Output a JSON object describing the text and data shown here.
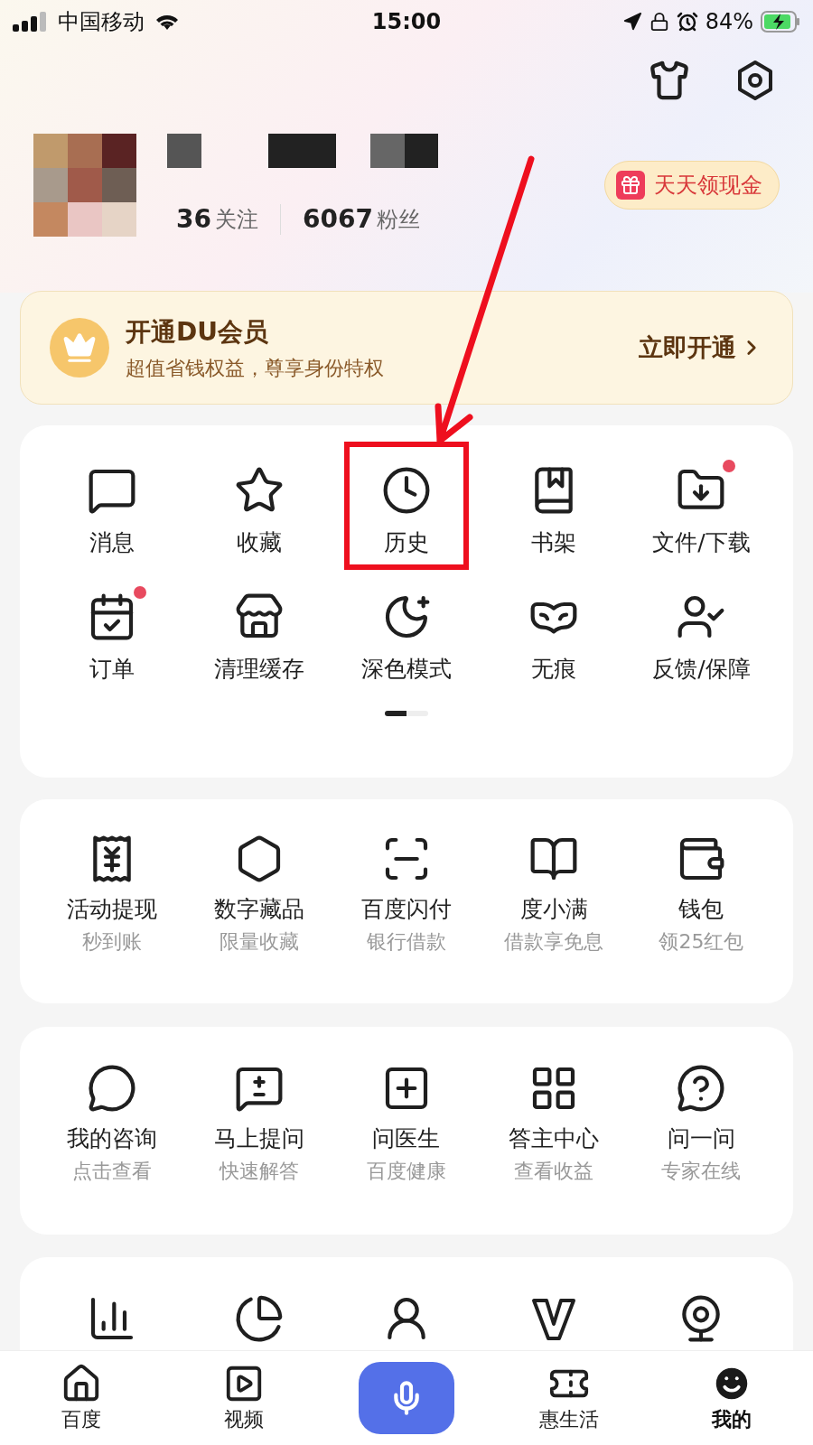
{
  "status_bar": {
    "carrier": "中国移动",
    "time": "15:00",
    "battery": "84%"
  },
  "profile": {
    "following_count": "36",
    "following_label": "关注",
    "followers_count": "6067",
    "followers_label": "粉丝",
    "cash_button": "天天领现金"
  },
  "vip_banner": {
    "title": "开通DU会员",
    "subtitle": "超值省钱权益，尊享身份特权",
    "action": "立即开通"
  },
  "shortcut_grid": {
    "items": [
      {
        "label": "消息",
        "badge": false,
        "highlighted": false
      },
      {
        "label": "收藏",
        "badge": false,
        "highlighted": false
      },
      {
        "label": "历史",
        "badge": false,
        "highlighted": true
      },
      {
        "label": "书架",
        "badge": false,
        "highlighted": false
      },
      {
        "label": "文件/下载",
        "badge": true,
        "highlighted": false
      },
      {
        "label": "订单",
        "badge": true,
        "highlighted": false
      },
      {
        "label": "清理缓存",
        "badge": false,
        "highlighted": false
      },
      {
        "label": "深色模式",
        "badge": false,
        "highlighted": false
      },
      {
        "label": "无痕",
        "badge": false,
        "highlighted": false
      },
      {
        "label": "反馈/保障",
        "badge": false,
        "highlighted": false
      }
    ],
    "pages": [
      {
        "selected": true
      },
      {
        "selected": false
      }
    ]
  },
  "finance_grid": {
    "items": [
      {
        "label": "活动提现",
        "subtitle": "秒到账"
      },
      {
        "label": "数字藏品",
        "subtitle": "限量收藏"
      },
      {
        "label": "百度闪付",
        "subtitle": "银行借款"
      },
      {
        "label": "度小满",
        "subtitle": "借款享免息"
      },
      {
        "label": "钱包",
        "subtitle": "领25红包"
      }
    ]
  },
  "qa_grid": {
    "items": [
      {
        "label": "我的咨询",
        "subtitle": "点击查看"
      },
      {
        "label": "马上提问",
        "subtitle": "快速解答"
      },
      {
        "label": "问医生",
        "subtitle": "百度健康"
      },
      {
        "label": "答主中心",
        "subtitle": "查看收益"
      },
      {
        "label": "问一问",
        "subtitle": "专家在线"
      }
    ]
  },
  "bottom_nav": [
    {
      "kind": "tab",
      "label": "百度",
      "selected": false
    },
    {
      "kind": "tab",
      "label": "视频",
      "selected": false
    },
    {
      "kind": "voice",
      "selected": false
    },
    {
      "kind": "tab",
      "label": "惠生活",
      "selected": false
    },
    {
      "kind": "tab",
      "label": "我的",
      "selected": true
    }
  ]
}
